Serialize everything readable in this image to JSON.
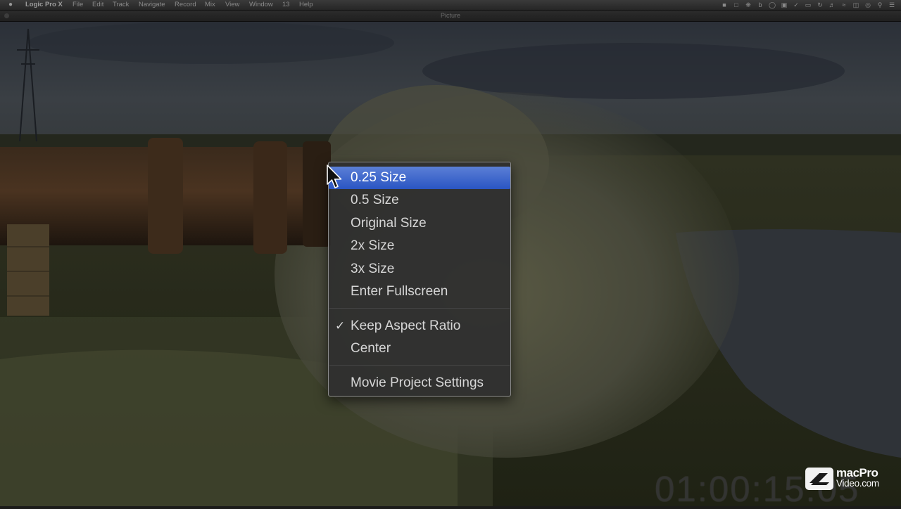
{
  "menubar": {
    "app_name": "Logic Pro X",
    "items": [
      "File",
      "Edit",
      "Track",
      "Navigate",
      "Record",
      "Mix",
      "View",
      "Window",
      "13",
      "Help"
    ]
  },
  "window": {
    "title": "Picture"
  },
  "context_menu": {
    "items": [
      {
        "label": "0.25 Size",
        "selected": true
      },
      {
        "label": "0.5 Size"
      },
      {
        "label": "Original Size"
      },
      {
        "label": "2x Size"
      },
      {
        "label": "3x Size"
      },
      {
        "label": "Enter Fullscreen"
      },
      {
        "label": "Keep Aspect Ratio",
        "checked": true,
        "check_glyph": "✓"
      },
      {
        "label": "Center"
      },
      {
        "label": "Movie Project Settings"
      }
    ]
  },
  "overlay": {
    "timecode": "01:00:15:05",
    "logo_line1": "macPro",
    "logo_line2": "Video.com"
  },
  "colors": {
    "selection": "#3a64cc",
    "menu_bg": "#2f2f2f",
    "menubar_bg": "#2f2f2f"
  },
  "icons": [
    "apple-icon",
    "wifi-icon",
    "volume-icon",
    "search-icon",
    "list-icon",
    "arrow-cursor-icon"
  ]
}
